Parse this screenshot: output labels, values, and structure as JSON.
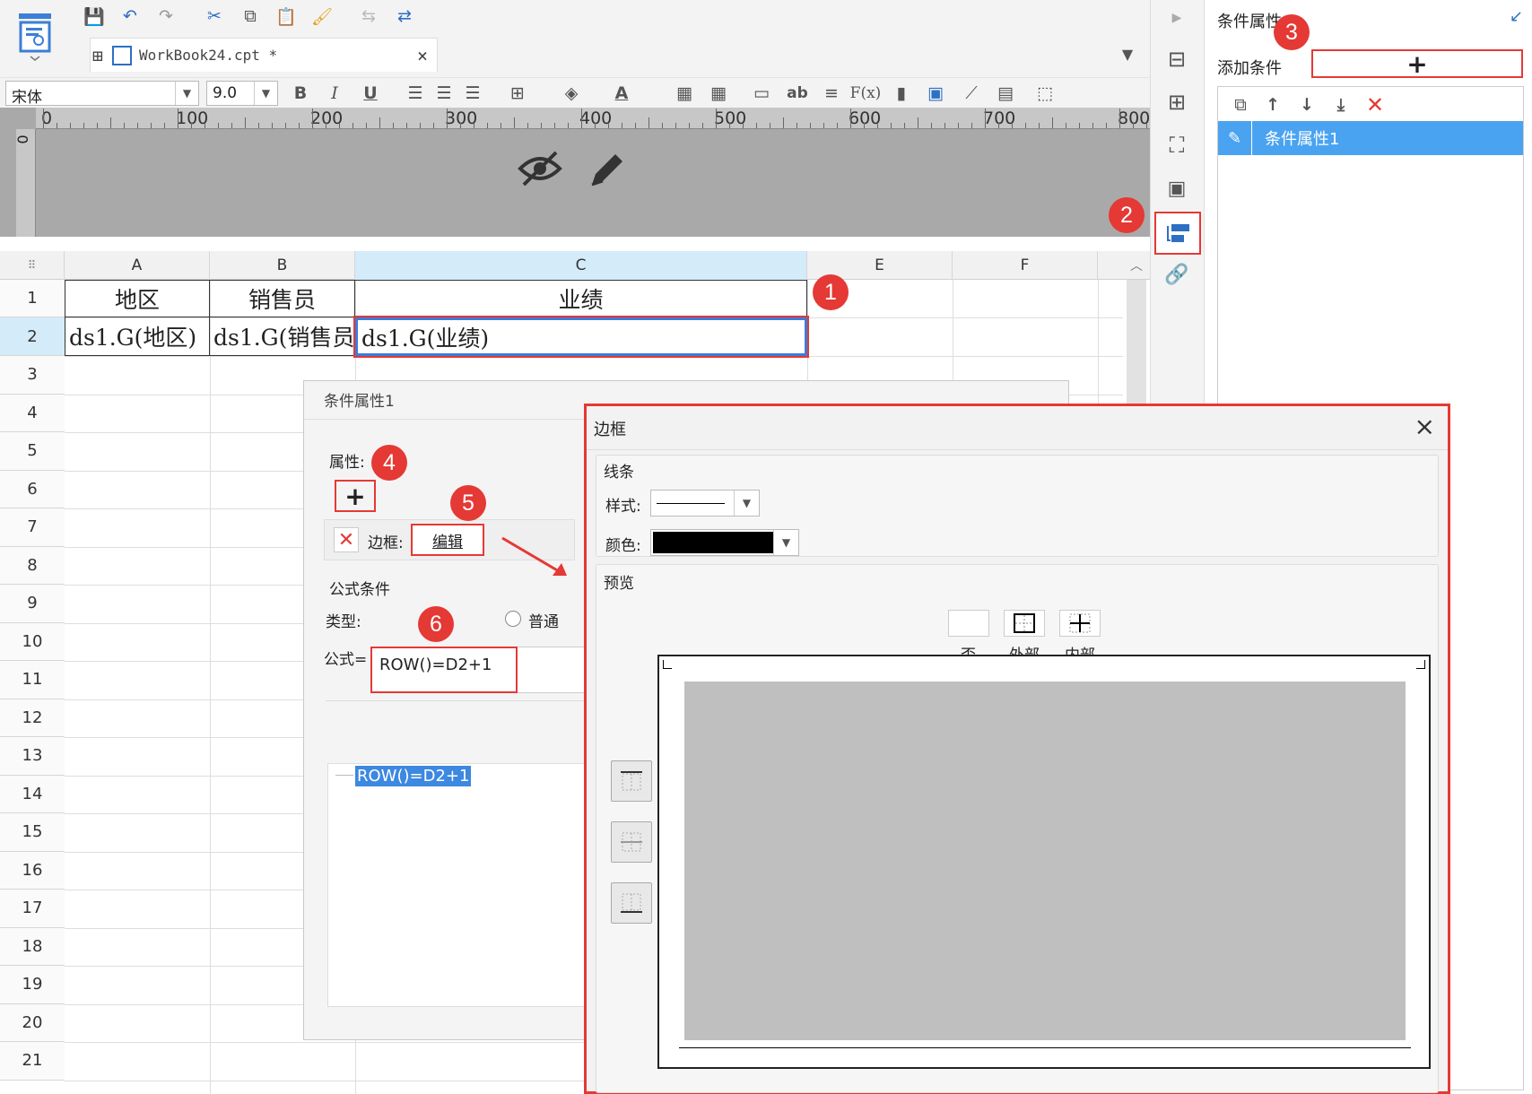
{
  "file_tab": {
    "name": "WorkBook24.cpt *"
  },
  "format_bar": {
    "font_name": "宋体",
    "font_size": "9.0",
    "bold": "B",
    "italic": "I",
    "underline": "U",
    "text_ab": "ab",
    "formula_fx": "F(x)"
  },
  "ruler": {
    "labels": [
      "0",
      "100",
      "200",
      "300",
      "400",
      "500",
      "600",
      "700",
      "800"
    ],
    "v_label": "0"
  },
  "columns": [
    "A",
    "B",
    "C",
    "E",
    "F"
  ],
  "rows": [
    "1",
    "2",
    "3",
    "4",
    "5",
    "6",
    "7",
    "8",
    "9",
    "10",
    "11",
    "12",
    "13",
    "14",
    "15",
    "16",
    "17",
    "18",
    "19",
    "20",
    "21"
  ],
  "cells": {
    "a1": "地区",
    "b1": "销售员",
    "c1": "业绩",
    "a2": "ds1.G(地区)",
    "b2": "ds1.G(销售员)",
    "c2": "ds1.G(业绩)"
  },
  "badges": [
    "1",
    "2",
    "3",
    "4",
    "5",
    "6"
  ],
  "right_panel": {
    "title": "条件属性",
    "add_condition": "添加条件",
    "plus": "+",
    "item": "条件属性1"
  },
  "cond_dialog": {
    "title": "条件属性1",
    "attr_label": "属性:",
    "plus": "+",
    "border_label": "边框:",
    "edit": "编辑",
    "formula_group": "公式条件",
    "type_label": "类型:",
    "radio_normal": "普通",
    "formula_label": "公式=",
    "formula_value": "ROW()=D2+1",
    "tree_item": "ROW()=D2+1"
  },
  "border_dialog": {
    "title": "边框",
    "line_group": "线条",
    "style_label": "样式:",
    "color_label": "颜色:",
    "color_value": "#000000",
    "preview_group": "预览",
    "preset_none": "否",
    "preset_outer": "外部",
    "preset_inner": "内部"
  },
  "colors": {
    "accent_red": "#e53935",
    "selection_blue": "#4aa3f0",
    "grid_selected": "#3d7bd9"
  }
}
